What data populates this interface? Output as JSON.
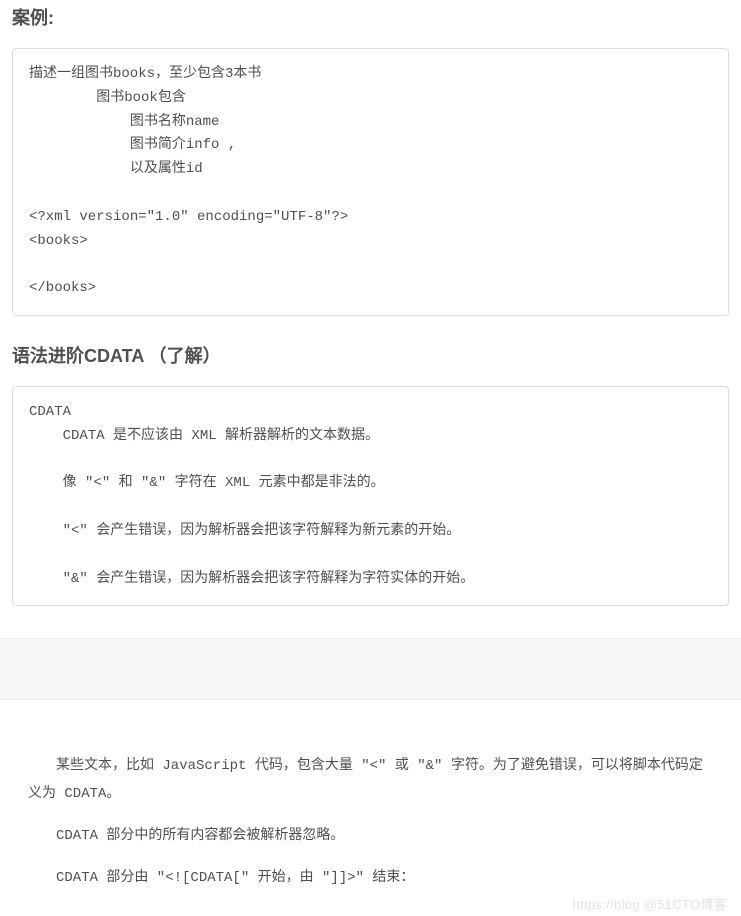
{
  "section1": {
    "heading": "案例:",
    "code": "描述一组图书books，至少包含3本书\n        图书book包含\n            图书名称name\n            图书简介info ,\n            以及属性id\n\n<?xml version=\"1.0\" encoding=\"UTF-8\"?>\n<books>\n\n</books>"
  },
  "section2": {
    "heading": "语法进阶CDATA （了解）",
    "code": "CDATA\n    CDATA 是不应该由 XML 解析器解析的文本数据。\n\n    像 \"<\" 和 \"&\" 字符在 XML 元素中都是非法的。\n\n    \"<\" 会产生错误，因为解析器会把该字符解释为新元素的开始。\n\n    \"&\" 会产生错误，因为解析器会把该字符解释为字符实体的开始。"
  },
  "section3": {
    "p1": "某些文本，比如 JavaScript 代码，包含大量 \"<\" 或 \"&\" 字符。为了避免错误，可以将脚本代码定义为 CDATA。",
    "p2": "CDATA 部分中的所有内容都会被解析器忽略。",
    "p3": "CDATA 部分由 \"<![CDATA[\" 开始，由 \"]]>\" 结束："
  },
  "watermark": "https://blog  @51CTO博客"
}
